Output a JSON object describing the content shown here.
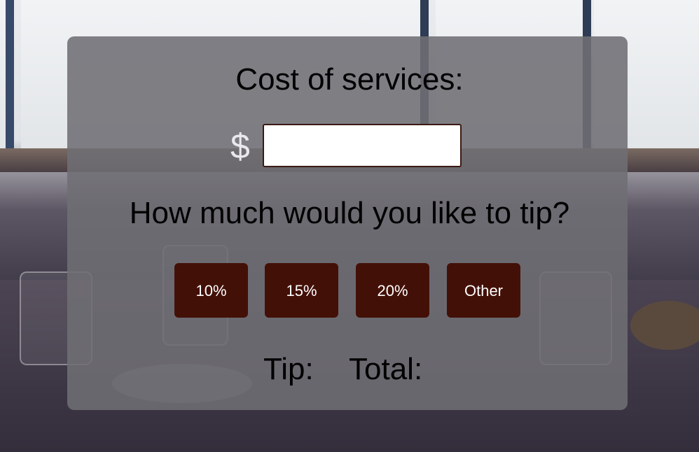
{
  "form": {
    "cost_label": "Cost of services:",
    "currency_symbol": "$",
    "cost_value": "",
    "tip_question": "How much would you like to tip?"
  },
  "tip_options": [
    {
      "label": "10%"
    },
    {
      "label": "15%"
    },
    {
      "label": "20%"
    },
    {
      "label": "Other"
    }
  ],
  "results": {
    "tip_label": "Tip:",
    "total_label": "Total:"
  },
  "colors": {
    "button_bg": "#431007",
    "panel_bg": "#706e74",
    "text": "#f4f3f6"
  }
}
